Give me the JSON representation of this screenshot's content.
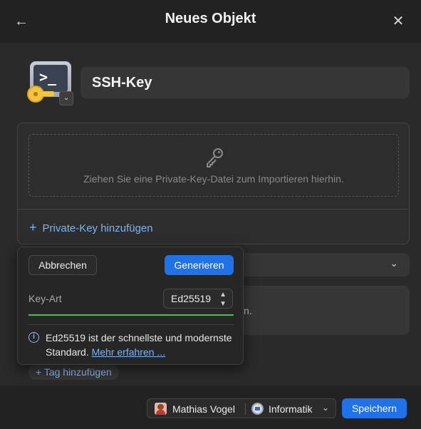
{
  "header": {
    "title": "Neues Objekt",
    "back_icon": "arrow-left-icon",
    "close_icon": "close-icon"
  },
  "item": {
    "icon": "terminal-key-icon",
    "title": "SSH-Key"
  },
  "import": {
    "drop_text": "Ziehen Sie eine Private-Key-Datei zum Importieren hierhin.",
    "add_private_key": "Private-Key hinzufügen"
  },
  "popover": {
    "cancel_label": "Abbrechen",
    "generate_label": "Generieren",
    "key_type_label": "Key-Art",
    "key_type_value": "Ed25519",
    "info_text": "Ed25519 ist der schnellste und modernste Standard.",
    "info_link": "Mehr erfahren ..."
  },
  "behind": {
    "peek_text": "n."
  },
  "tags": {
    "add_label": "Tag hinzufügen"
  },
  "footer": {
    "owner": "Mathias Vogel",
    "vault": "Informatik",
    "save_label": "Speichern"
  },
  "colors": {
    "accent": "#1f72e8",
    "link": "#7db3f2",
    "strength": "#3cc23f",
    "background": "#2a2a2a"
  }
}
